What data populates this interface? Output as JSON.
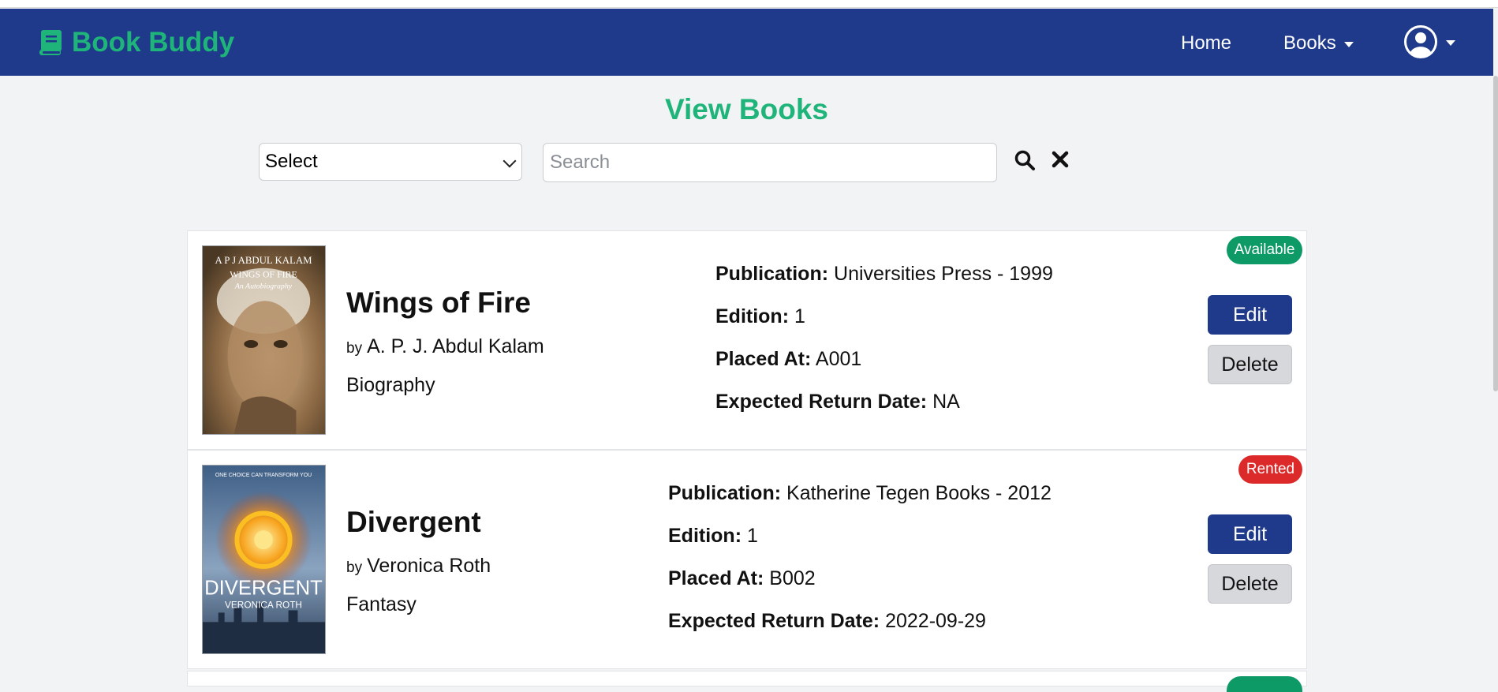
{
  "brand": {
    "name": "Book Buddy",
    "color": "#1fb57a"
  },
  "nav": {
    "home": "Home",
    "books": "Books"
  },
  "page": {
    "title": "View Books"
  },
  "filters": {
    "select_value": "Select",
    "search_placeholder": "Search"
  },
  "books": [
    {
      "title": "Wings of Fire",
      "by": "by",
      "author": "A. P. J. Abdul Kalam",
      "genre": "Biography",
      "publication_label": "Publication:",
      "publication": "Universities Press - 1999",
      "edition_label": "Edition:",
      "edition": "1",
      "placed_label": "Placed At:",
      "placed": "A001",
      "return_label": "Expected Return Date:",
      "return_date": "NA",
      "status": "Available",
      "edit": "Edit",
      "delete": "Delete",
      "cover_text": [
        "A P J ABDUL KALAM",
        "WINGS OF FIRE",
        "An Autobiography"
      ]
    },
    {
      "title": "Divergent",
      "by": "by",
      "author": "Veronica Roth",
      "genre": "Fantasy",
      "publication_label": "Publication:",
      "publication": "Katherine Tegen Books - 2012",
      "edition_label": "Edition:",
      "edition": "1",
      "placed_label": "Placed At:",
      "placed": "B002",
      "return_label": "Expected Return Date:",
      "return_date": "2022-09-29",
      "status": "Rented",
      "edit": "Edit",
      "delete": "Delete",
      "cover_text": [
        "ONE CHOICE CAN TRANSFORM YOU",
        "DIVERGENT",
        "VERONICA ROTH"
      ]
    }
  ],
  "colors": {
    "navbar": "#1f3a8a",
    "available": "#0e9a66",
    "rented": "#dc2a2a",
    "edit_button": "#1f3a8a",
    "delete_button": "#d6d8dc"
  }
}
